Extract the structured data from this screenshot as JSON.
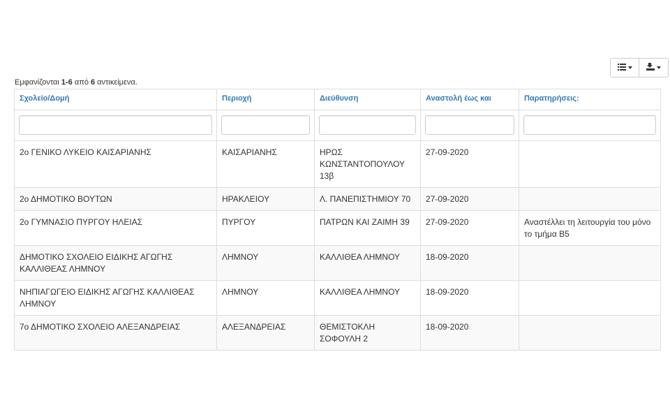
{
  "toolbar": {
    "columns_icon": "list-icon",
    "export_icon": "export-icon"
  },
  "summary": {
    "prefix": "Εμφανίζονται ",
    "range": "1-6",
    "middle": " από ",
    "total": "6",
    "suffix": " αντικείμενα."
  },
  "table": {
    "headers": [
      "Σχολείο/Δομή",
      "Περιοχή",
      "Διεύθυνση",
      "Αναστολή έως και",
      "Παρατηρήσεις:"
    ],
    "rows": [
      [
        "2ο ΓΕΝΙΚΟ ΛΥΚΕΙΟ ΚΑΙΣΑΡΙΑΝΗΣ",
        "ΚΑΙΣΑΡΙΑΝΗΣ",
        "ΗΡΩΣ ΚΩΝΣΤΑΝΤΟΠΟΥΛΟΥ 13β",
        "27-09-2020",
        ""
      ],
      [
        "2ο ΔΗΜΟΤΙΚΟ ΒΟΥΤΩΝ",
        "ΗΡΑΚΛΕΙΟΥ",
        "Λ. ΠΑΝΕΠΙΣΤΗΜΙΟΥ 70",
        "27-09-2020",
        ""
      ],
      [
        "2ο ΓΥΜΝΑΣΙΟ ΠΥΡΓΟΥ ΗΛΕΙΑΣ",
        "ΠΥΡΓΟΥ",
        "ΠΑΤΡΩΝ ΚΑΙ ΖΑΙΜΗ 39",
        "27-09-2020",
        "Αναστέλλει τη λειτουργία του μόνο το τμήμα Β5"
      ],
      [
        "ΔΗΜΟΤΙΚΟ ΣΧΟΛΕΙΟ ΕΙΔΙΚΗΣ ΑΓΩΓΗΣ ΚΑΛΛΙΘΕΑΣ ΛΗΜΝΟΥ",
        "ΛΗΜΝΟΥ",
        "ΚΑΛΛΙΘΕΑ ΛΗΜΝΟΥ",
        "18-09-2020",
        ""
      ],
      [
        "ΝΗΠΙΑΓΩΓΕΙΟ ΕΙΔΙΚΗΣ ΑΓΩΓΗΣ ΚΑΛΛΙΘΕΑΣ ΛΗΜΝΟΥ",
        "ΛΗΜΝΟΥ",
        "ΚΑΛΛΙΘΕΑ ΛΗΜΝΟΥ",
        "18-09-2020",
        ""
      ],
      [
        "7ο ΔΗΜΟΤΙΚΟ ΣΧΟΛΕΙΟ ΑΛΕΞΑΝΔΡΕΙΑΣ",
        "ΑΛΕΞΑΝΔΡΕΙΑΣ",
        "ΘΕΜΙΣΤΟΚΛΗ ΣΟΦΟΥΛΗ 2",
        "18-09-2020",
        ""
      ]
    ]
  }
}
